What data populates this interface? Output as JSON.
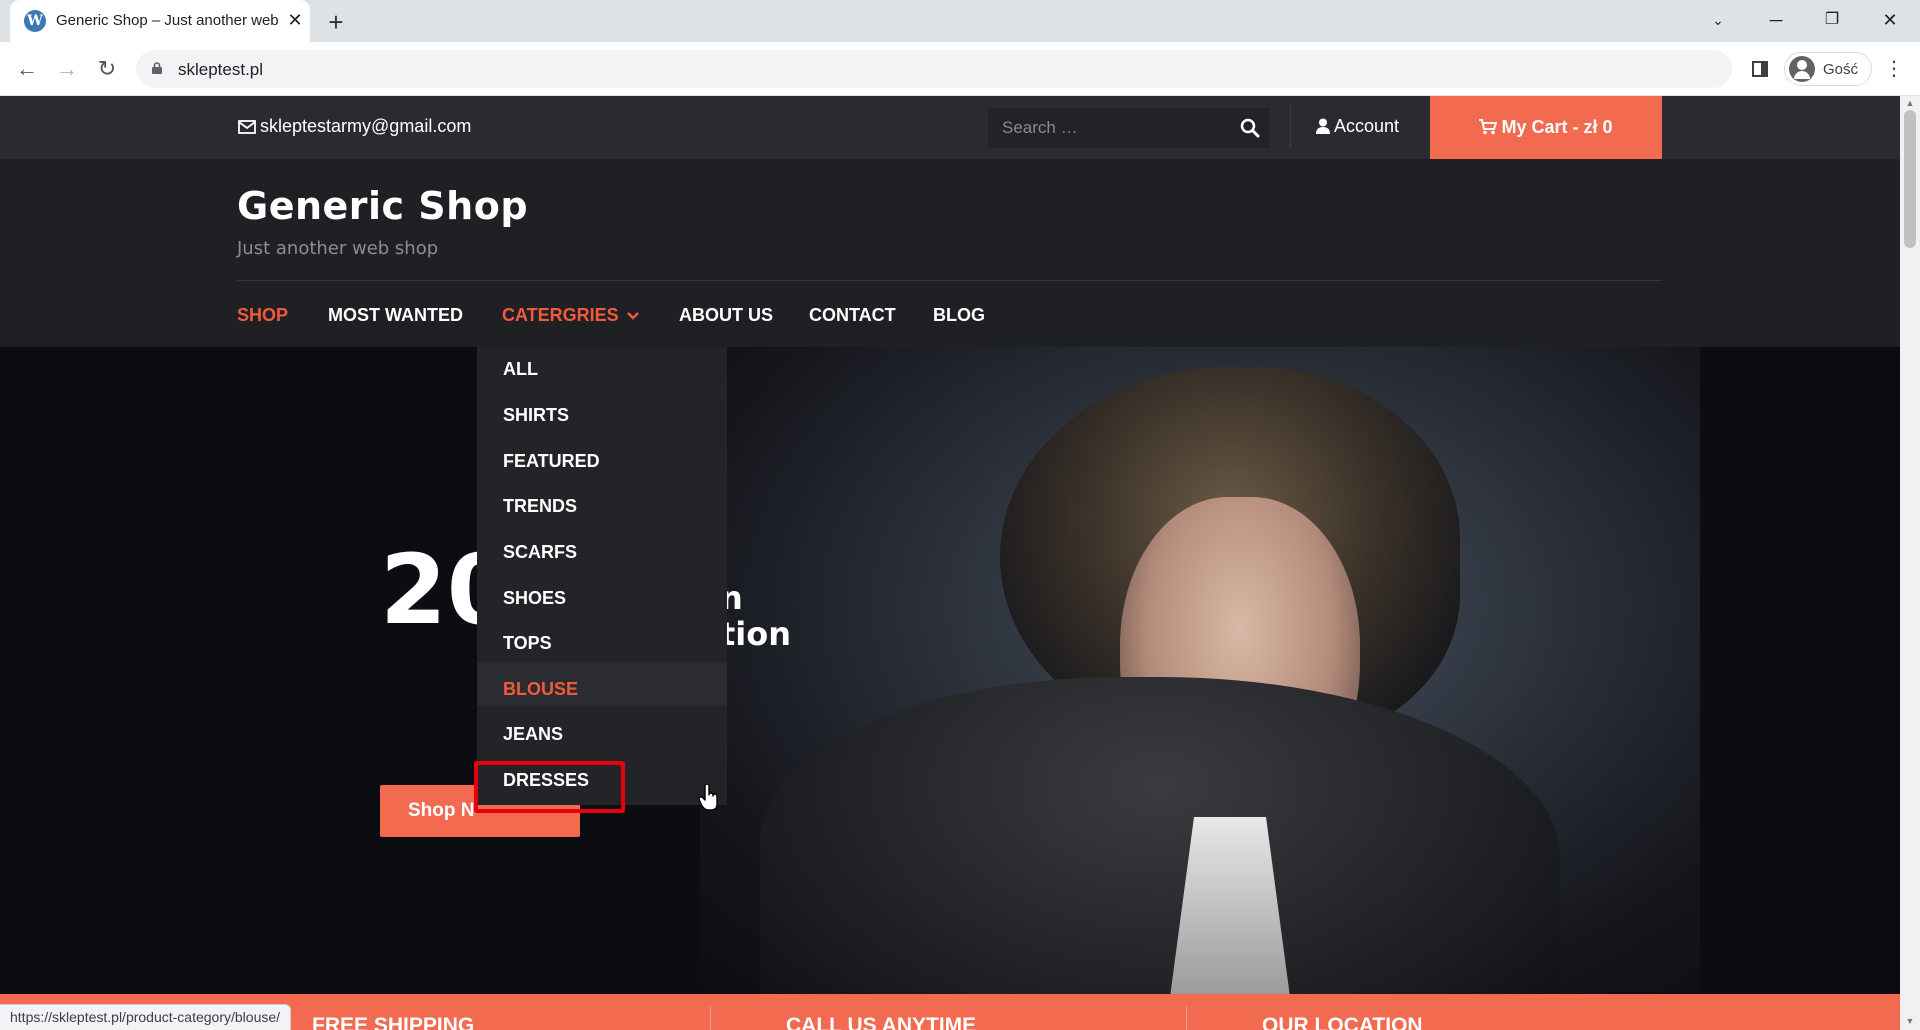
{
  "browser": {
    "tab_title": "Generic Shop – Just another web shop",
    "url": "skleptest.pl",
    "profile_name": "Gość",
    "status_url": "https://skleptest.pl/product-category/blouse/"
  },
  "topbar": {
    "email": "skleptestarmy@gmail.com",
    "search_placeholder": "Search …",
    "account_label": "Account",
    "cart_label": "My Cart - zł 0"
  },
  "header": {
    "site_title": "Generic Shop",
    "tagline": "Just another web shop"
  },
  "nav": {
    "items": [
      {
        "label": "SHOP",
        "active": true
      },
      {
        "label": "MOST WANTED"
      },
      {
        "label": "CATERGRIES",
        "active": true,
        "has_dropdown": true
      },
      {
        "label": "ABOUT US"
      },
      {
        "label": "CONTACT"
      },
      {
        "label": "BLOG"
      }
    ]
  },
  "dropdown": {
    "items": [
      "ALL",
      "SHIRTS",
      "FEATURED",
      "TRENDS",
      "SCARFS",
      "SHOES",
      "TOPS",
      "BLOUSE",
      "JEANS",
      "DRESSES"
    ],
    "hovered": "BLOUSE"
  },
  "hero": {
    "title_visible": "20",
    "sub_line1_visible": "n",
    "sub_line2_visible": "tion",
    "button_visible": "Shop N"
  },
  "infobar": {
    "items": [
      "FREE SHIPPING",
      "CALL US ANYTIME",
      "OUR LOCATION"
    ]
  },
  "colors": {
    "accent": "#f26a4f",
    "active_link": "#f25a3c",
    "topbar_bg": "#2a2b30",
    "header_bg": "#1f2024",
    "highlight_box": "#e8000b"
  }
}
